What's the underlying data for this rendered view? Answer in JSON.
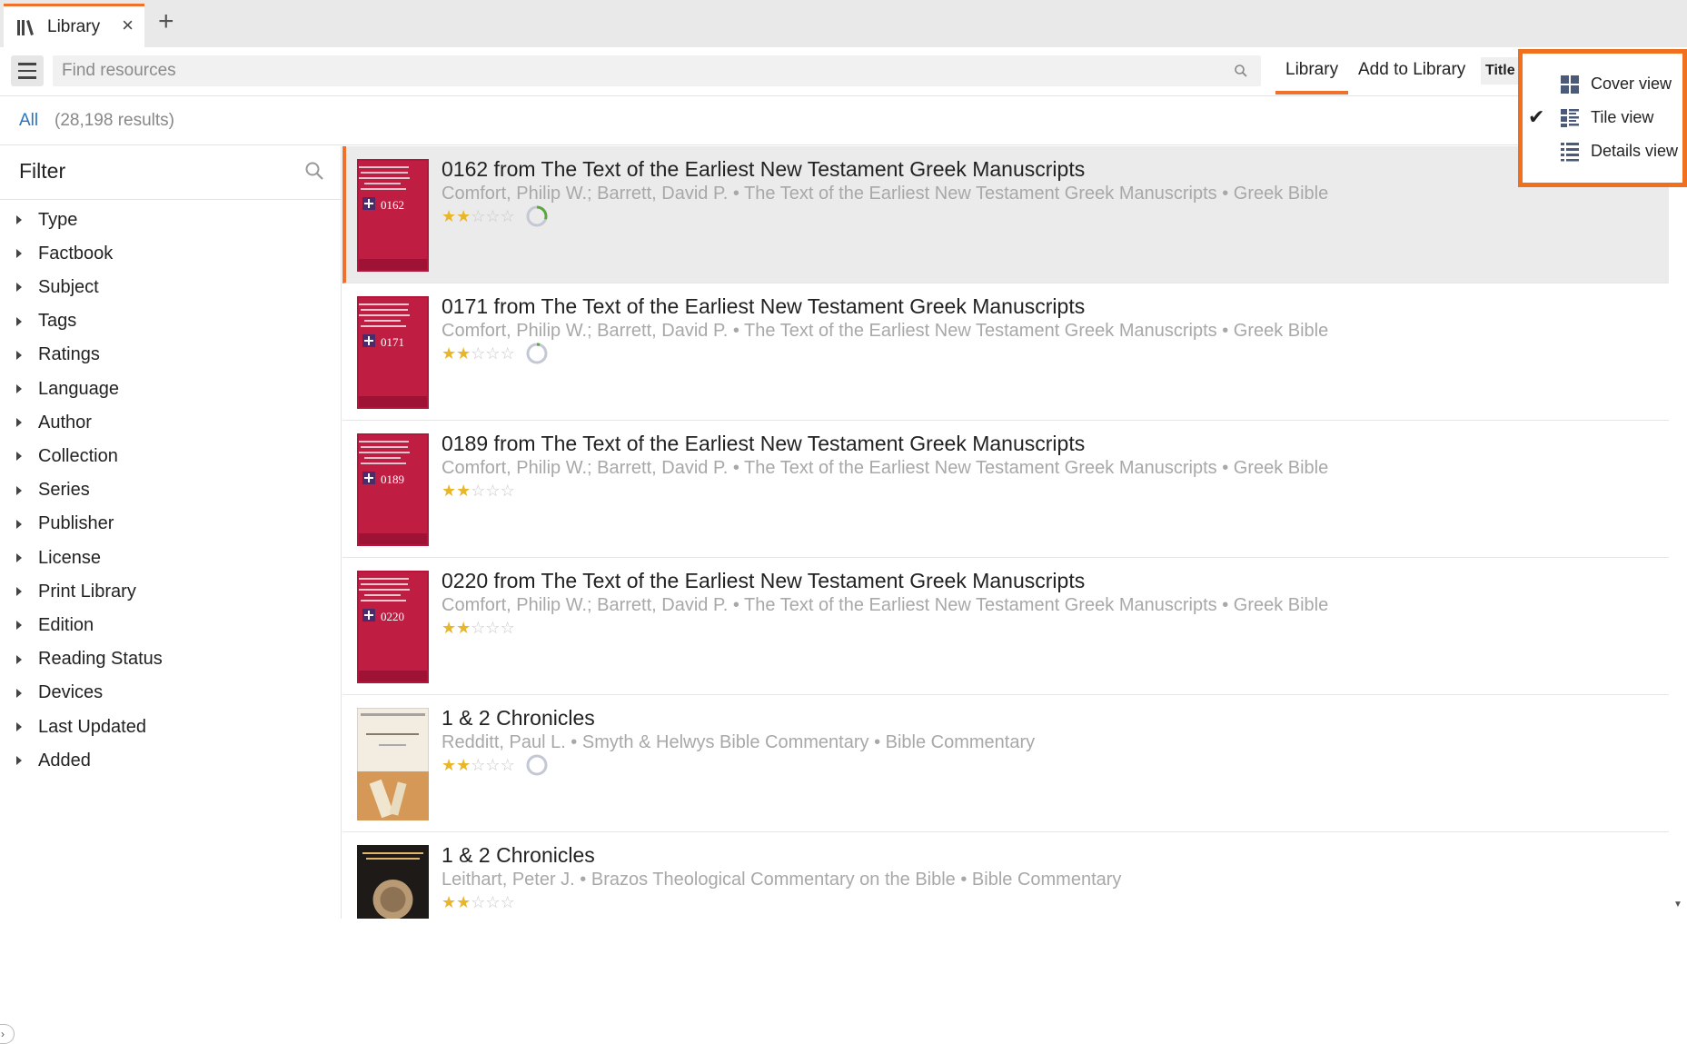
{
  "tab": {
    "label": "Library",
    "icon": "library-books-icon",
    "close_icon": "close-icon",
    "add_icon": "plus-icon"
  },
  "toolbar": {
    "search_placeholder": "Find resources",
    "library_tab": "Library",
    "add_to_library": "Add to Library",
    "sort_label": "Title"
  },
  "results": {
    "all_label": "All",
    "count": "(28,198 results)"
  },
  "filter": {
    "title": "Filter",
    "facets": [
      "Type",
      "Factbook",
      "Subject",
      "Tags",
      "Ratings",
      "Language",
      "Author",
      "Collection",
      "Series",
      "Publisher",
      "License",
      "Print Library",
      "Edition",
      "Reading Status",
      "Devices",
      "Last Updated",
      "Added"
    ]
  },
  "view_menu": {
    "items": [
      {
        "label": "Cover view",
        "icon": "cover-view-icon",
        "checked": false
      },
      {
        "label": "Tile view",
        "icon": "tile-view-icon",
        "checked": true
      },
      {
        "label": "Details view",
        "icon": "details-view-icon",
        "checked": false
      }
    ]
  },
  "resources": [
    {
      "title": "0162 from The Text of the Earliest New Testament Greek Manuscripts",
      "meta": "Comfort, Philip W.; Barrett, David P. • The Text of the Earliest New Testament Greek Manuscripts • Greek Bible",
      "rating": 2,
      "progress": 0.3,
      "progress_color": "#5aa83c",
      "cover_style": "red-cross",
      "cover_number": "0162",
      "selected": true
    },
    {
      "title": "0171 from The Text of the Earliest New Testament Greek Manuscripts",
      "meta": "Comfort, Philip W.; Barrett, David P. • The Text of the Earliest New Testament Greek Manuscripts • Greek Bible",
      "rating": 2,
      "progress": 0.05,
      "progress_color": "#5aa83c",
      "cover_style": "red-cross",
      "cover_number": "0171",
      "selected": false
    },
    {
      "title": "0189 from The Text of the Earliest New Testament Greek Manuscripts",
      "meta": "Comfort, Philip W.; Barrett, David P. • The Text of the Earliest New Testament Greek Manuscripts • Greek Bible",
      "rating": 2,
      "progress": null,
      "cover_style": "red-cross",
      "cover_number": "0189",
      "selected": false
    },
    {
      "title": "0220 from The Text of the Earliest New Testament Greek Manuscripts",
      "meta": "Comfort, Philip W.; Barrett, David P. • The Text of the Earliest New Testament Greek Manuscripts • Greek Bible",
      "rating": 2,
      "progress": null,
      "cover_style": "red-cross",
      "cover_number": "0220",
      "selected": false
    },
    {
      "title": "1 & 2 Chronicles",
      "meta": "Redditt, Paul L. • Smyth & Helwys Bible Commentary • Bible Commentary",
      "rating": 2,
      "progress": 0,
      "progress_color": "#5aa83c",
      "cover_style": "scroll",
      "cover_number": "",
      "selected": false
    },
    {
      "title": "1 & 2 Chronicles",
      "meta": "Leithart, Peter J. • Brazos Theological Commentary on the Bible • Bible Commentary",
      "rating": 2,
      "progress": null,
      "cover_style": "dark",
      "cover_number": "",
      "selected": false
    }
  ],
  "colors": {
    "accent": "#f0712c",
    "link": "#2a73c4",
    "star": "#e9b62a",
    "highlight_border": "#f0701e"
  }
}
